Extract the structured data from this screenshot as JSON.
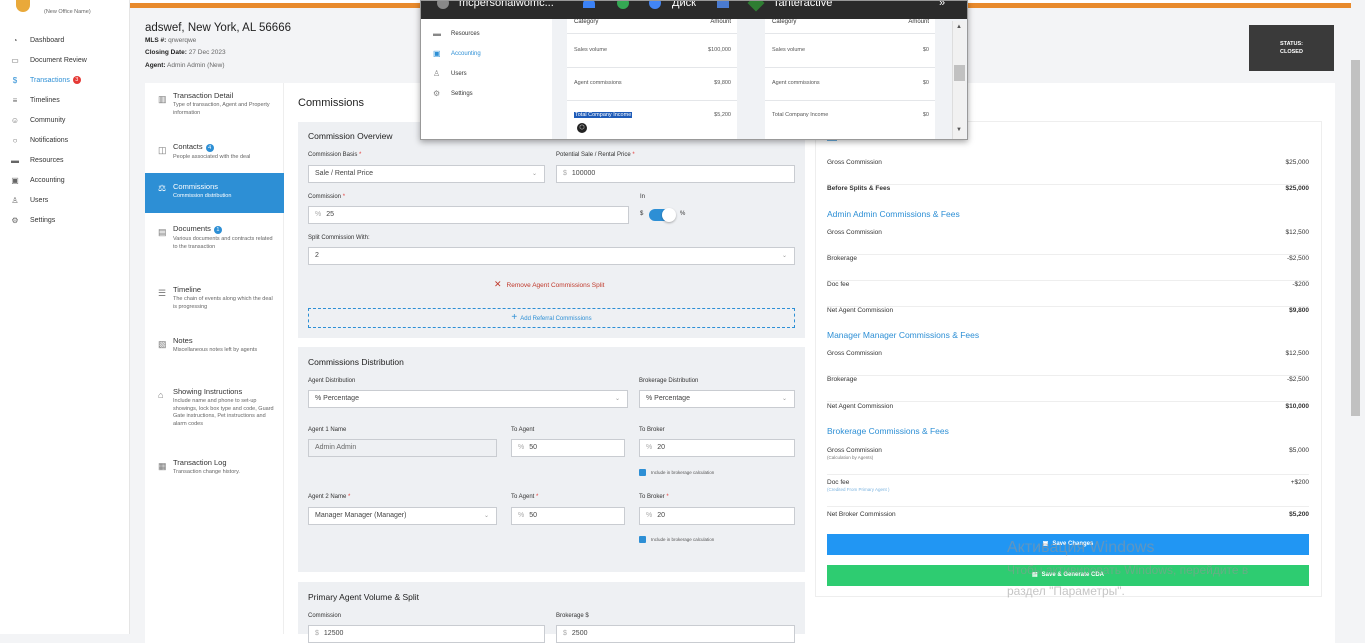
{
  "office_name": "(New Office Name)",
  "sidebar": {
    "items": [
      {
        "label": "Dashboard",
        "icon": "dashboard-icon"
      },
      {
        "label": "Document Review",
        "icon": "document-icon"
      },
      {
        "label": "Transactions",
        "icon": "dollar-icon",
        "badge": "3",
        "active": true
      },
      {
        "label": "Timelines",
        "icon": "timeline-icon"
      },
      {
        "label": "Community",
        "icon": "community-icon"
      },
      {
        "label": "Notifications",
        "icon": "bell-icon"
      },
      {
        "label": "Resources",
        "icon": "folder-icon"
      },
      {
        "label": "Accounting",
        "icon": "accounting-icon"
      },
      {
        "label": "Users",
        "icon": "user-icon"
      },
      {
        "label": "Settings",
        "icon": "gear-icon"
      }
    ]
  },
  "header": {
    "title": "adswef, New York, AL 56666",
    "mls_label": "MLS #:",
    "mls_value": "qrwerqwe",
    "closing_label": "Closing Date:",
    "closing_value": "27 Dec 2023",
    "agent_label": "Agent:",
    "agent_value": "Admin Admin (New)",
    "status_label": "STATUS:",
    "status_value": "CLOSED"
  },
  "steps": [
    {
      "title": "Transaction Detail",
      "desc": "Type of transaction, Agent and Property information"
    },
    {
      "title": "Contacts",
      "badge": "4",
      "desc": "People associated with the deal"
    },
    {
      "title": "Commissions",
      "desc": "Commission distribution",
      "active": true
    },
    {
      "title": "Documents",
      "badge": "1",
      "desc": "Various documents and contracts related to the transaction"
    },
    {
      "title": "Timeline",
      "desc": "The chain of events along which the deal is progressing"
    },
    {
      "title": "Notes",
      "desc": "Miscellaneous notes left by agents"
    },
    {
      "title": "Showing Instructions",
      "desc": "Include name and phone to set-up showings, lock box type and code, Guard Gate instructions, Pet instructions and alarm codes"
    },
    {
      "title": "Transaction Log",
      "desc": "Transaction change history."
    }
  ],
  "page_title": "Commissions",
  "overview": {
    "title": "Commission Overview",
    "basis_label": "Commission Basis",
    "basis_value": "Sale / Rental Price",
    "potential_label": "Potential Sale / Rental Price",
    "potential_prefix": "$",
    "potential_value": "100000",
    "commission_label": "Commission",
    "commission_prefix": "%",
    "commission_value": "25",
    "in_label": "In",
    "toggle_left": "$",
    "toggle_right": "%",
    "split_label": "Split Commission With:",
    "split_value": "2",
    "remove_split": "Remove Agent Commissions Split",
    "add_referral": "Add Referral Commissions"
  },
  "distribution": {
    "title": "Commissions Distribution",
    "agent_dist_label": "Agent Distribution",
    "agent_dist_value": "% Percentage",
    "brokerage_dist_label": "Brokerage Distribution",
    "brokerage_dist_value": "% Percentage",
    "agent1_label": "Agent 1 Name",
    "agent1_value": "Admin Admin",
    "to_agent_label": "To Agent",
    "to_broker_label": "To Broker",
    "agent1_to_agent": "50",
    "agent1_to_broker": "20",
    "include_label": "Include in brokerage calculation",
    "agent2_label": "Agent 2 Name",
    "agent2_value": "Manager Manager (Manager)",
    "agent2_to_agent": "50",
    "agent2_to_broker": "20",
    "percent_prefix": "%"
  },
  "primary": {
    "title": "Primary Agent Volume & Split",
    "commission_label": "Commission",
    "brokerage_label": "Brokerage $",
    "commission_value": "12500",
    "brokerage_value": "2500"
  },
  "summary": {
    "gross_commission_label": "Gross Commission",
    "gross_commission_value": "$25,000",
    "before_splits_label": "Before Splits & Fees",
    "before_splits_value": "$25,000",
    "admin_head": "Admin Admin Commissions & Fees",
    "admin_gross": "$12,500",
    "brokerage_label": "Brokerage",
    "admin_brokerage": "-$2,500",
    "doc_fee_label": "Doc fee",
    "admin_doc_fee": "-$200",
    "net_agent_label": "Net Agent Commission",
    "admin_net": "$9,800",
    "manager_head": "Manager Manager Commissions & Fees",
    "manager_gross": "$12,500",
    "manager_brokerage": "-$2,500",
    "manager_net": "$10,000",
    "broker_head": "Brokerage Commissions & Fees",
    "broker_gross": "$5,000",
    "broker_gross_sub": "(Calculation by Agents)",
    "broker_doc_fee": "+$200",
    "broker_doc_sub": "(Credited From Primary Agent )",
    "net_broker_label": "Net Broker Commission",
    "net_broker_value": "$5,200",
    "save_button": "Save Changes",
    "save_cda_button": "Save & Generate CDA"
  },
  "watermark": {
    "line1": "Активация Windows",
    "line2": "Чтобы активировать Windows, перейдите в",
    "line3": "раздел \"Параметры\"."
  },
  "popup": {
    "tabs": [
      "mcpersonalwomc...",
      "Диск",
      "Tanteractive"
    ],
    "nav": [
      {
        "label": "Resources",
        "icon": "folder-icon"
      },
      {
        "label": "Accounting",
        "icon": "accounting-icon",
        "active": true
      },
      {
        "label": "Users",
        "icon": "user-icon"
      },
      {
        "label": "Settings",
        "icon": "gear-icon"
      }
    ],
    "table1": {
      "headers": [
        "Category",
        "Amount"
      ],
      "rows": [
        [
          "Sales volume",
          "$100,000"
        ],
        [
          "Agent commissions",
          "$9,800"
        ],
        [
          "Total Company Income",
          "$5,200"
        ]
      ]
    },
    "table2": {
      "headers": [
        "Category",
        "Amount"
      ],
      "rows": [
        [
          "Sales volume",
          "$0"
        ],
        [
          "Agent commissions",
          "$0"
        ],
        [
          "Total Company Income",
          "$0"
        ]
      ]
    }
  },
  "colors": {
    "accent": "#2d8fd5",
    "orange": "#e88a2c",
    "green": "#2ecc71",
    "status_bg": "#3a3a3a"
  }
}
